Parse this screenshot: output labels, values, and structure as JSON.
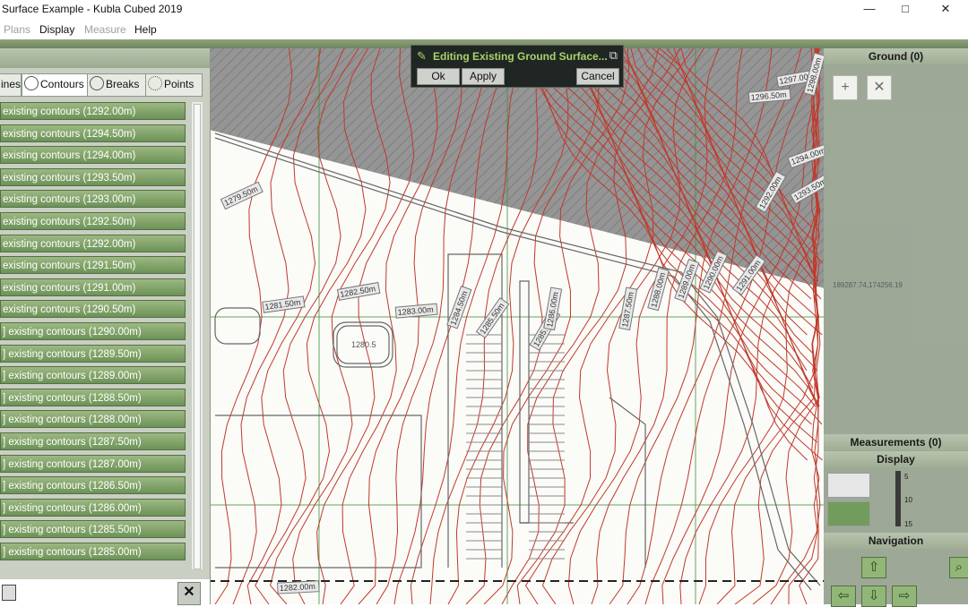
{
  "window": {
    "title": "Surface Example - Kubla Cubed 2019",
    "controls": [
      "—",
      "□",
      "✕"
    ]
  },
  "menu": {
    "items": [
      {
        "label": "Plans",
        "enabled": false
      },
      {
        "label": "Display",
        "enabled": true
      },
      {
        "label": "Measure",
        "enabled": false
      },
      {
        "label": "Help",
        "enabled": true
      }
    ]
  },
  "left_panel": {
    "tabs": [
      {
        "label": "ines",
        "icon": "lines-icon"
      },
      {
        "label": "Contours",
        "icon": "contours-icon",
        "active": true
      },
      {
        "label": "Breaks",
        "icon": "breaks-icon"
      },
      {
        "label": "Points",
        "icon": "points-icon"
      }
    ],
    "contour_items": [
      "existing contours (1292.00m)",
      "existing contours (1294.50m)",
      "existing contours (1294.00m)",
      "existing contours (1293.50m)",
      "existing contours (1293.00m)",
      "existing contours (1292.50m)",
      "existing contours (1292.00m)",
      "existing contours (1291.50m)",
      "existing contours (1291.00m)",
      "existing contours (1290.50m)",
      "] existing contours (1290.00m)",
      "] existing contours (1289.50m)",
      "] existing contours (1289.00m)",
      "] existing contours (1288.50m)",
      "] existing contours (1288.00m)",
      "] existing contours (1287.50m)",
      "] existing contours (1287.00m)",
      "] existing contours (1286.50m)",
      "] existing contours (1286.00m)",
      "] existing contours (1285.50m)",
      "] existing contours (1285.00m)"
    ],
    "close_label": "✕"
  },
  "dialog": {
    "title": "Editing Existing Ground Surface...",
    "ok": "Ok",
    "apply": "Apply",
    "cancel": "Cancel"
  },
  "right_panel": {
    "ground_header": "Ground (0)",
    "add_label": "+",
    "remove_label": "✕",
    "measurements_header": "Measurements (0)",
    "display_header": "Display",
    "navigation_header": "Navigation",
    "coord_readout": "189287.74,174256.19",
    "display_scale": [
      "5",
      "10",
      "15"
    ]
  },
  "canvas": {
    "contour_labels": [
      "1279.50m",
      "1281.50m",
      "1282.50m",
      "1283.00m",
      "1284.50m",
      "1285.50m",
      "1285.00m",
      "1286.00m",
      "1287.50m",
      "1288.00m",
      "1289.00m",
      "1290.00m",
      "1291.00m",
      "1292.00m",
      "1293.50m",
      "1294.00m",
      "1296.50m",
      "1297.00m",
      "1298.00m",
      "1282.00m",
      "1280.5"
    ],
    "colors": {
      "contour": "#c0392b",
      "hatch": "#7b7b7b",
      "grid": "#3e8f3e"
    }
  }
}
